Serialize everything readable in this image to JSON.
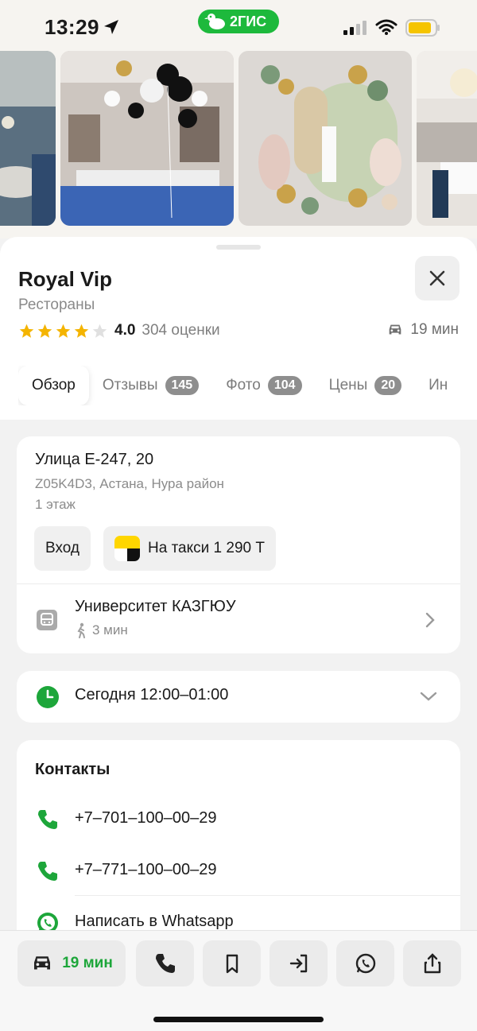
{
  "status_bar": {
    "time": "13:29",
    "app_badge": "2ГИС",
    "battery_color": "#f5c400"
  },
  "photos": [
    {
      "name": "hall-blue-chairs"
    },
    {
      "name": "black-white-balloons"
    },
    {
      "name": "birthday-balloon-arch"
    },
    {
      "name": "hall-chandelier"
    }
  ],
  "place": {
    "title": "Royal Vip",
    "category": "Рестораны",
    "rating": "4.0",
    "rating_count": "304 оценки",
    "rating_stars_filled": 4,
    "drive_time": "19 мин"
  },
  "tabs": [
    {
      "label": "Обзор",
      "active": true,
      "count": ""
    },
    {
      "label": "Отзывы",
      "count": "145"
    },
    {
      "label": "Фото",
      "count": "104"
    },
    {
      "label": "Цены",
      "count": "20"
    },
    {
      "label": "Ин",
      "count": ""
    }
  ],
  "address": {
    "street": "Улица Е-247, 20",
    "details": "Z05K4D3, Астана, Нура район",
    "floor": "1 этаж",
    "entrance_label": "Вход",
    "taxi_label": "На такси 1 290 Т"
  },
  "transit": {
    "stop_name": "Университет КАЗГЮУ",
    "walk_time": "3 мин"
  },
  "hours": {
    "text": "Сегодня 12:00–01:00"
  },
  "contacts": {
    "title": "Контакты",
    "phones": [
      "+7‒701‒100‒00‒29",
      "+7‒771‒100‒00‒29"
    ],
    "whatsapp_label": "Написать в Whatsapp"
  },
  "bottom_bar": {
    "drive_label": "19 мин"
  },
  "colors": {
    "accent_green": "#1da63a",
    "star": "#f4b400",
    "badge": "#8e8e8e"
  }
}
